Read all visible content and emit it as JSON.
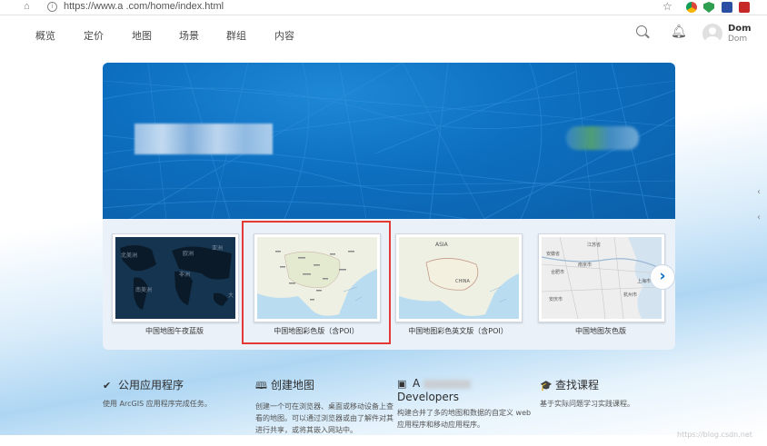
{
  "browser": {
    "url": "https://www.a       .com/home/index.html",
    "icons": [
      "home-icon",
      "info-icon",
      "star-icon",
      "chrome-icon",
      "shield-icon",
      "picture-icon",
      "adblock-icon"
    ]
  },
  "nav": {
    "items": [
      "概览",
      "定价",
      "地图",
      "场景",
      "群组",
      "内容"
    ],
    "user_name": "Dom",
    "user_sub": "Dom"
  },
  "hero": {
    "title_blurred": "ArcGIS",
    "colors": {
      "hero_blue": "#0d6fc0"
    }
  },
  "carousel": {
    "cards": [
      {
        "label": "中国地图午夜蓝版",
        "map_style": "dark-blue"
      },
      {
        "label": "中国地图彩色版（含POI）",
        "map_style": "color-poi"
      },
      {
        "label": "中国地图彩色英文版（含POI）",
        "map_style": "color-english",
        "map_texts": [
          "ASIA",
          "CHINA"
        ]
      },
      {
        "label": "中国地图灰色版",
        "map_style": "gray",
        "map_texts": [
          "南京市",
          "上海市",
          "杭州市",
          "合肥市",
          "安庆市"
        ]
      }
    ],
    "dark_map_texts": [
      "北美洲",
      "欧洲",
      "亚洲",
      "非洲",
      "南美洲",
      "大"
    ],
    "next_icon": "chevron-right-icon",
    "highlight_color": "#e53935"
  },
  "features": [
    {
      "icon": "checkmark-icon",
      "glyph": "✔",
      "title": "公用应用程序",
      "desc": "使用 ArcGIS 应用程序完成任务。"
    },
    {
      "icon": "book-map-icon",
      "glyph": "🕮",
      "title": "创建地图",
      "desc": "创建一个可在浏览器、桌面或移动设备上查看的地图。可以通过浏览器或由了解件对其进行共享，或将其嵌入网站中。"
    },
    {
      "icon": "developer-window-icon",
      "glyph": "▣",
      "title": "A",
      "title2": "Developers",
      "desc": "构建合并了多的地图和数据的自定义 web 应用程序和移动应用程序。"
    },
    {
      "icon": "graduation-cap-icon",
      "glyph": "🎓",
      "title": "查找课程",
      "desc": "基于实际问题学习实践课程。"
    }
  ],
  "watermark": "https://blog.csdn.net"
}
